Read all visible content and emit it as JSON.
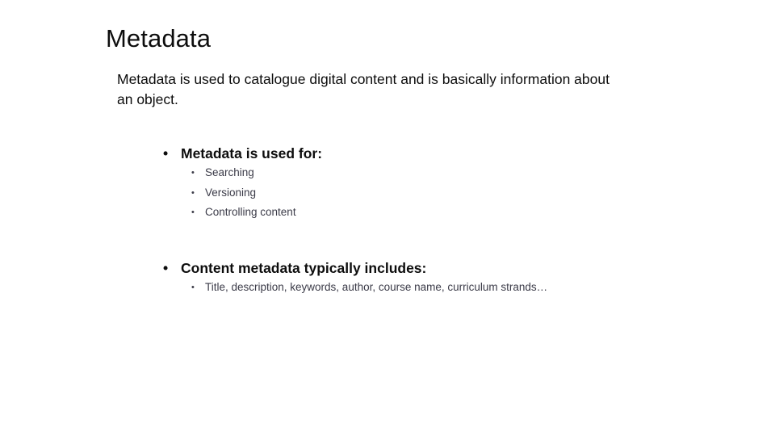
{
  "slide": {
    "title": "Metadata",
    "intro_paragraph": "Metadata is used to catalogue digital content and is basically information about an object.",
    "bullet_glyph_level1": "•",
    "bullet_glyph_level2": "•",
    "sections": [
      {
        "heading": "Metadata is used for:",
        "items": [
          "Searching",
          "Versioning",
          "Controlling content"
        ]
      },
      {
        "heading": "Content metadata typically includes:",
        "items": [
          "Title, description, keywords, author, course name, curriculum strands…"
        ]
      }
    ]
  },
  "colors": {
    "background": "#ffffff",
    "title_text": "#0d0d0d",
    "body_text": "#0d0d0d",
    "sub_bullet_text": "#3b3b48"
  }
}
